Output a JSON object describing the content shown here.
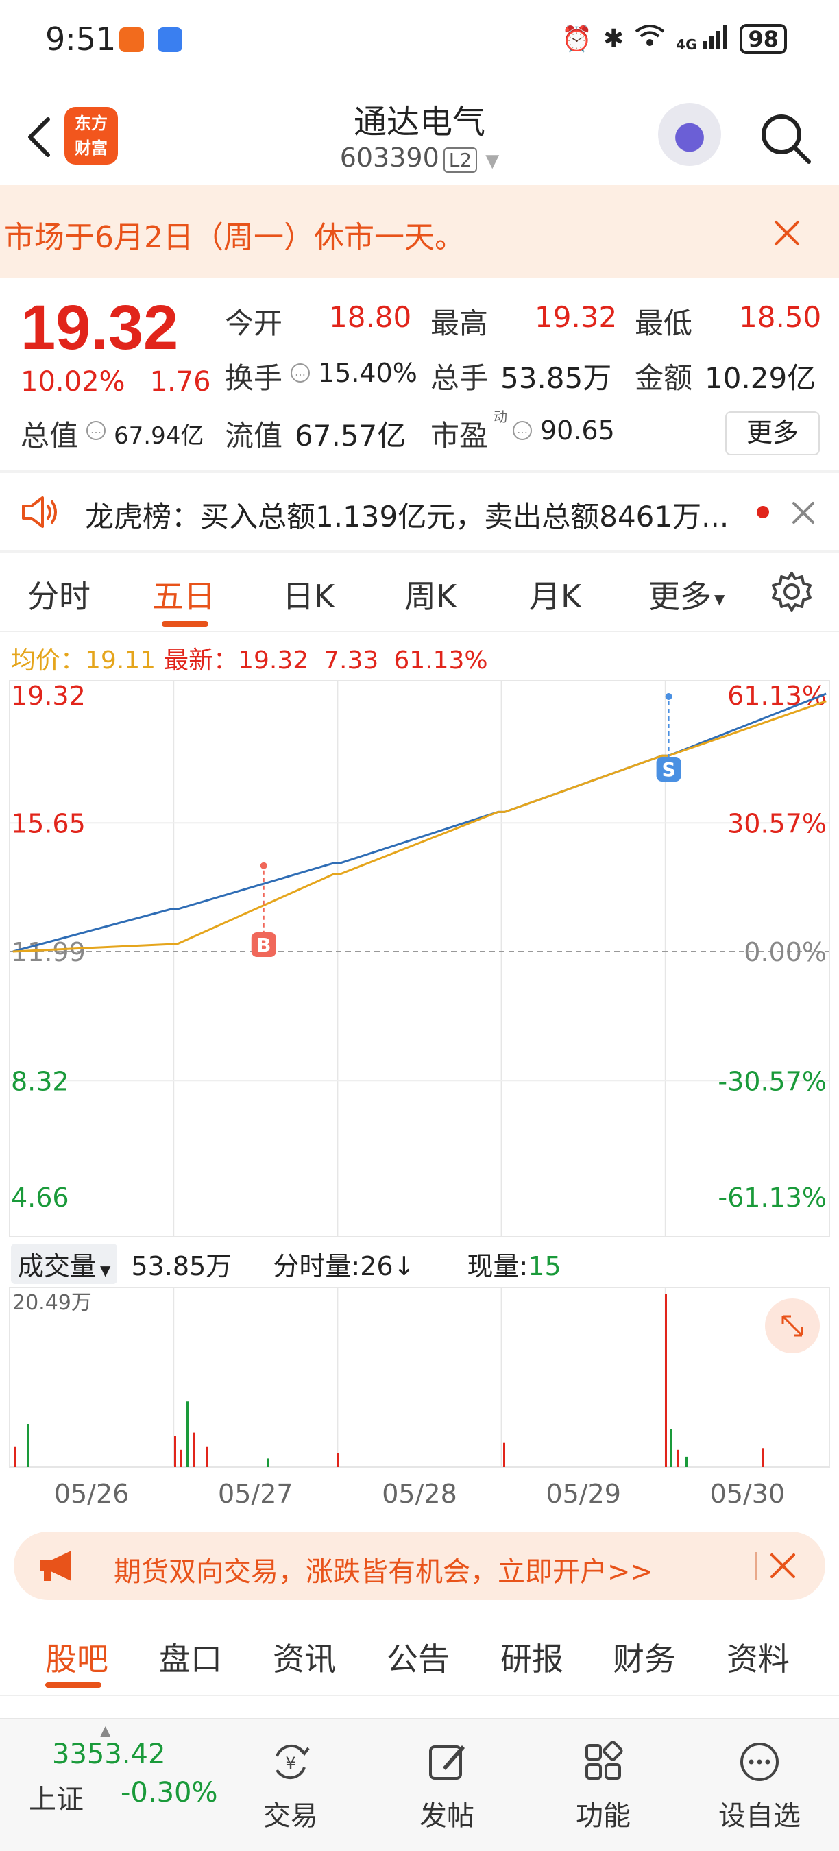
{
  "status_bar": {
    "time": "9:51",
    "network": "4G",
    "battery": "98"
  },
  "header": {
    "stock_name": "通达电气",
    "stock_code": "603390",
    "level": "L2",
    "logo_line1": "东方",
    "logo_line2": "财富"
  },
  "notice": {
    "text": "市场于6月2日（周一）休市一天。"
  },
  "quote": {
    "price": "19.32",
    "change_pct": "10.02%",
    "change": "1.76",
    "open_label": "今开",
    "open": "18.80",
    "high_label": "最高",
    "high": "19.32",
    "low_label": "最低",
    "low": "18.50",
    "turnover_label": "换手",
    "turnover": "15.40%",
    "volume_label": "总手",
    "volume": "53.85万",
    "amount_label": "金额",
    "amount": "10.29亿",
    "mktcap_label": "总值",
    "mktcap": "67.94亿",
    "float_label": "流值",
    "float_cap": "67.57亿",
    "pe_label": "市盈",
    "pe_sup": "动",
    "pe": "90.65",
    "more_label": "更多"
  },
  "dragon_tiger": {
    "text": "龙虎榜：买入总额1.139亿元，卖出总额8461万..."
  },
  "chart_tabs": [
    "分时",
    "五日",
    "日K",
    "周K",
    "月K",
    "更多"
  ],
  "chart_tab_active": "五日",
  "legend": {
    "avg_label": "均价：",
    "avg": "19.11",
    "latest_label": "最新：",
    "latest": "19.32",
    "change": "7.33",
    "pct": "61.13%"
  },
  "chart_data": {
    "type": "line",
    "x": [
      "05/26",
      "05/27",
      "05/28",
      "05/29",
      "05/30"
    ],
    "y_left_ticks": [
      "19.32",
      "15.65",
      "11.99",
      "8.32",
      "4.66"
    ],
    "y_right_ticks": [
      "61.13%",
      "30.57%",
      "0.00%",
      "-30.57%",
      "-61.13%"
    ],
    "ylim": [
      4.66,
      19.32
    ],
    "base": 11.99,
    "series": [
      {
        "values": [
          11.99,
          13.19,
          13.19,
          14.51,
          14.51,
          15.96,
          15.96,
          17.56,
          17.56,
          19.32
        ]
      },
      {
        "values": [
          11.99,
          12.2,
          12.2,
          14.2,
          14.2,
          15.96,
          15.96,
          17.56,
          17.56,
          19.11
        ]
      }
    ],
    "markers": [
      {
        "label": "B",
        "day": "05/27",
        "price": 14.51
      },
      {
        "label": "S",
        "day": "05/30",
        "price": 19.32
      }
    ],
    "colors": {
      "price": "#2f6db5",
      "avg": "#e5a51c",
      "up": "#e1251b",
      "down": "#1a9a3a"
    }
  },
  "volume": {
    "selector": "成交量",
    "total": "53.85万",
    "tick_label": "分时量:",
    "tick": "26↓",
    "now_label": "现量:",
    "now": "15",
    "max": "20.49万",
    "bars": [
      0.12,
      0.25,
      0.18,
      0.1,
      0.38,
      0.2,
      0.12,
      0.05,
      0.08,
      0.14,
      0.06,
      0.11,
      1.0,
      0.22,
      0.1
    ]
  },
  "ad": {
    "text": "期货双向交易，涨跌皆有机会，立即开户>>"
  },
  "sub_tabs": [
    "股吧",
    "盘口",
    "资讯",
    "公告",
    "研报",
    "财务",
    "资料"
  ],
  "sub_tab_active": "股吧",
  "bottom_nav": {
    "index_value": "3353.42",
    "index_name": "上证",
    "index_pct": "-0.30%",
    "items": [
      "交易",
      "发帖",
      "功能",
      "设自选"
    ]
  }
}
